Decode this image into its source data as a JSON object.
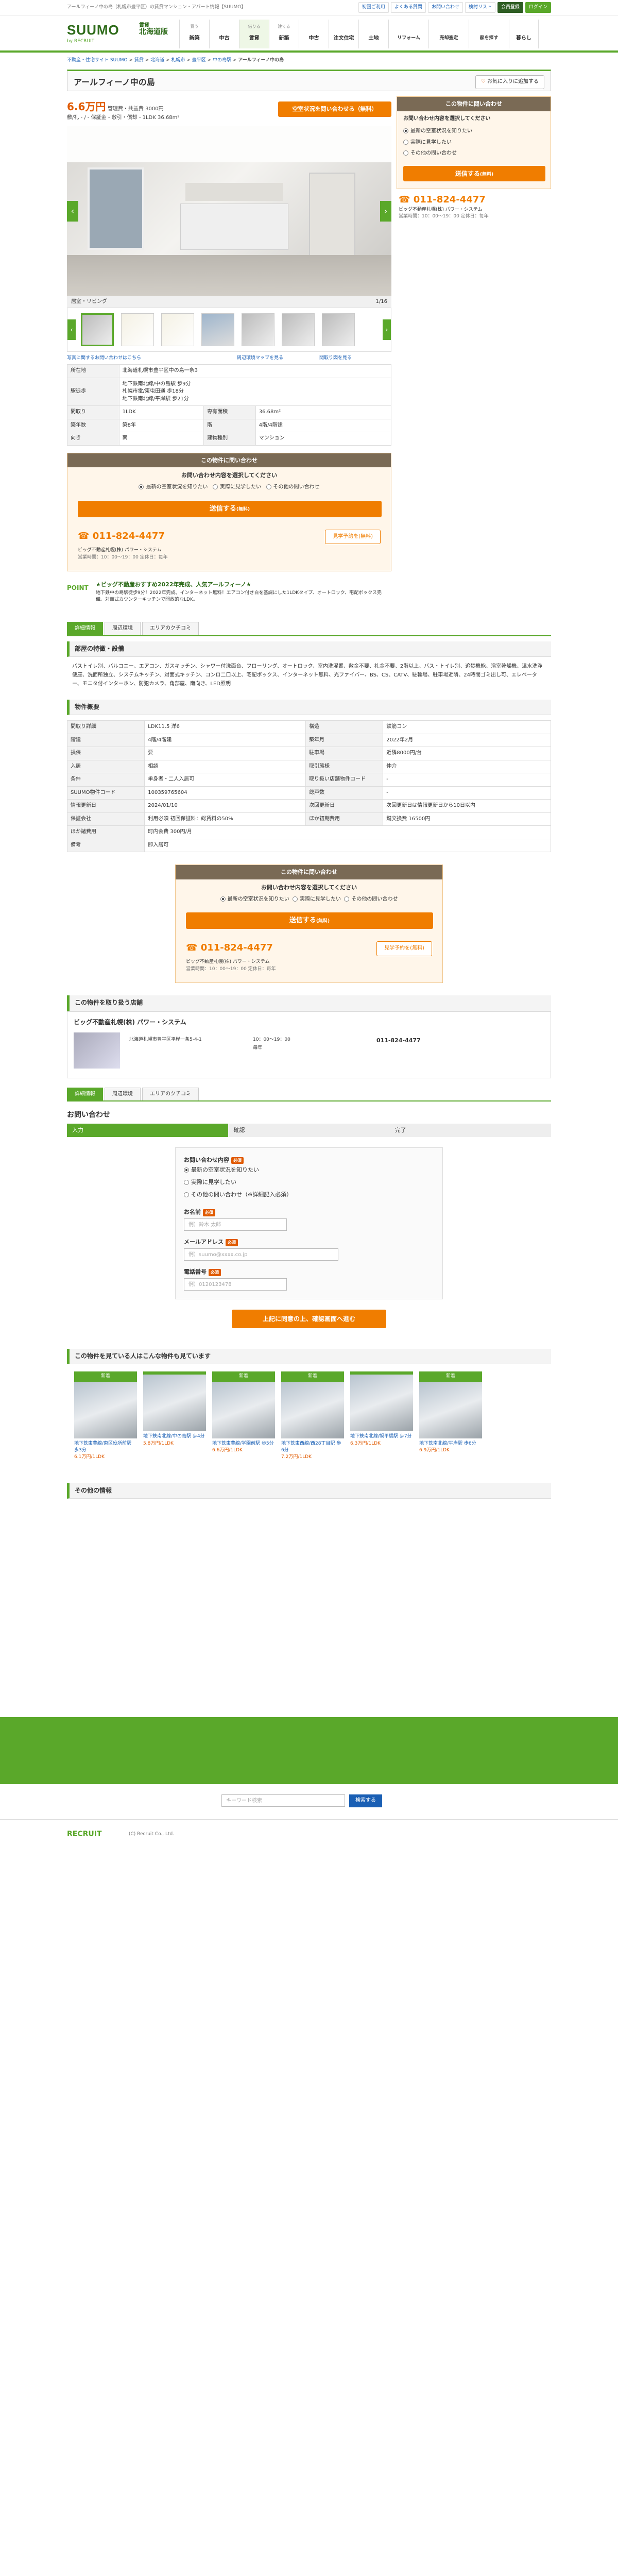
{
  "topbar": {
    "text": "アールフィーノ中の島（札幌市豊平区）の賃貸マンション・アパート情報【SUUMO】",
    "links": [
      "初回ご利用",
      "よくある質問",
      "お問い合わせ",
      "検討リスト",
      "会員登録",
      "ログイン"
    ]
  },
  "header": {
    "logo": "SUUMO",
    "logo_sub": "by RECRUIT",
    "area_pre": "賃貸",
    "area": "北海道版",
    "nav": [
      {
        "sm": "買う",
        "label": "新築"
      },
      {
        "sm": "",
        "label": "中古"
      },
      {
        "sm": "借りる",
        "label": "賃貸"
      },
      {
        "sm": "建てる",
        "label": "新築"
      },
      {
        "sm": "",
        "label": "中古"
      },
      {
        "sm": "",
        "label": "注文住宅"
      },
      {
        "sm": "",
        "label": "土地"
      },
      {
        "sm": "",
        "label": "リフォーム"
      },
      {
        "sm": "",
        "label": "売却査定"
      },
      {
        "sm": "",
        "label": "家を探す"
      },
      {
        "sm": "",
        "label": "暮らし"
      }
    ]
  },
  "breadcrumb": [
    "不動産・住宅サイト SUUMO",
    "賃貸",
    "北海道",
    "札幌市",
    "豊平区",
    "中の島駅",
    "アールフィーノ中の島"
  ],
  "title": "アールフィーノ中の島",
  "fav": "お気に入りに追加する",
  "price": "6.6万円",
  "price_sub": "管理費・共益費 3000円",
  "spec_line": "敷/礼 - / - 保証金 - 敷引・償却 - 1LDK 36.68m²",
  "inquire_btn": "空室状況を問い合わせる（無料）",
  "photo_caption": "居室・リビング",
  "photo_count": "1/16",
  "photo_links": [
    "写真に関するお問い合わせはこちら",
    "周辺環境マップを見る",
    "間取り図を見る"
  ],
  "basic_table": [
    [
      "所在地",
      "北海道札幌市豊平区中の島一条3"
    ],
    [
      "駅徒歩",
      "地下鉄南北線/中の島駅 歩9分\n札幌市電/東屯田通 歩18分\n地下鉄南北線/平岸駅 歩21分"
    ],
    [
      "間取り",
      "1LDK",
      "専有面積",
      "36.68m²"
    ],
    [
      "築年数",
      "築8年",
      "階",
      "4階/4階建"
    ],
    [
      "向き",
      "南",
      "建物種別",
      "マンション"
    ]
  ],
  "inquiry": {
    "head": "この物件に問い合わせ",
    "q": "お問い合わせ内容を選択してください",
    "opts": [
      "最新の空室状況を知りたい",
      "実際に見学したい",
      "その他の問い合わせ"
    ],
    "send": "送信する",
    "send_sub": "(無料)",
    "tel": "011-824-4477",
    "visit_btn": "見学予約を(無料)",
    "company": "ビッグ不動産札幌(株) パワー・システム",
    "hours": "営業時間：10：00〜19：00 定休日：毎年"
  },
  "point": {
    "tag": "POINT",
    "text": "★ビッグ不動産おすすめ2022年完成、人気アールフィーノ★",
    "sub": "地下鉄中の島駅徒歩9分！2022年完成。インターネット無料！エアコン付き白を基調にした1LDKタイプ、オートロック、宅配ボックス完備。対面式カウンターキッチンで開放的なLDK。"
  },
  "tabs": [
    "詳細情報",
    "周辺環境",
    "エリアのクチコミ"
  ],
  "features_head": "部屋の特徴・設備",
  "features": "バストイレ別、バルコニー、エアコン、ガスキッチン、シャワー付洗面台、フローリング、オートロック、室内洗濯置、敷金不要、礼金不要、2階以上、バス・トイレ別、追焚機能、浴室乾燥機、温水洗浄便座、洗面所独立、システムキッチン、対面式キッチン、コンロ二口以上、宅配ボックス、インターネット無料、光ファイバー、BS、CS、CATV、駐輪場、駐車場近隣、24時間ゴミ出し可、エレベーター、モニタ付インターホン、防犯カメラ、角部屋、南向き、LED照明",
  "outline_head": "物件概要",
  "outline": [
    [
      "間取り詳細",
      "LDK11.5 洋6",
      "構造",
      "鉄筋コン"
    ],
    [
      "階建",
      "4階/4階建",
      "築年月",
      "2022年2月"
    ],
    [
      "損保",
      "要",
      "駐車場",
      "近隣8000円/台"
    ],
    [
      "入居",
      "相談",
      "取引態様",
      "仲介"
    ],
    [
      "条件",
      "単身者・二人入居可",
      "取り扱い店舗物件コード",
      "-"
    ],
    [
      "SUUMO物件コード",
      "100359765604",
      "総戸数",
      "-"
    ],
    [
      "情報更新日",
      "2024/01/10",
      "次回更新日",
      "次回更新日は情報更新日から10日以内"
    ],
    [
      "保証会社",
      "利用必須 初回保証料：総賃料の50%",
      "ほか初期費用",
      "鍵交換費 16500円"
    ],
    [
      "ほか諸費用",
      "町内会費 300円/月"
    ],
    [
      "備考",
      "即入居可"
    ]
  ],
  "company_head": "この物件を取り扱う店舗",
  "company": {
    "name": "ビッグ不動産札幌(株) パワー・システム",
    "addr": "北海道札幌市豊平区平岸一条5-4-1",
    "hours": "10：00〜19：00",
    "closed": "毎年",
    "tel": "011-824-4477"
  },
  "form": {
    "head": "お問い合わせ",
    "steps": [
      "入力",
      "確認",
      "完了"
    ],
    "req_label": "お問い合わせ内容",
    "opts": [
      "最新の空室状況を知りたい",
      "実際に見学したい",
      "その他の問い合わせ（※詳細記入必須）"
    ],
    "name_label": "お名前",
    "name_ph": "例）鈴木 太郎",
    "email_label": "メールアドレス",
    "email_ph": "例）suumo@xxxx.co.jp",
    "tel_label": "電話番号",
    "tel_ph": "例）0120123478",
    "submit": "上記に同意の上、確認画面へ進む"
  },
  "similar_head": "この物件を見ている人はこんな物件も見ています",
  "similar": [
    {
      "h": "新着",
      "t": "地下鉄東豊線/東区役所前駅 歩3分",
      "p": "6.1万円/1LDK"
    },
    {
      "h": "",
      "t": "地下鉄南北線/中の島駅 歩4分",
      "p": "5.8万円/1LDK"
    },
    {
      "h": "新着",
      "t": "地下鉄東豊線/学園前駅 歩5分",
      "p": "6.6万円/1LDK"
    },
    {
      "h": "新着",
      "t": "地下鉄東西線/西28丁目駅 歩6分",
      "p": "7.2万円/1LDK"
    },
    {
      "h": "",
      "t": "地下鉄南北線/幌平橋駅 歩7分",
      "p": "6.3万円/1LDK"
    },
    {
      "h": "新着",
      "t": "地下鉄南北線/平岸駅 歩6分",
      "p": "6.9万円/1LDK"
    }
  ],
  "others_head": "その他の情報",
  "footer": {
    "search_label": "",
    "search_ph": "キーワード検索",
    "search_btn": "検索する",
    "brand": "RECRUIT",
    "copyright": "(C) Recruit Co., Ltd."
  },
  "colors": {
    "accent": "#5aa82a",
    "orange": "#f07d00",
    "price": "#e05a00"
  }
}
